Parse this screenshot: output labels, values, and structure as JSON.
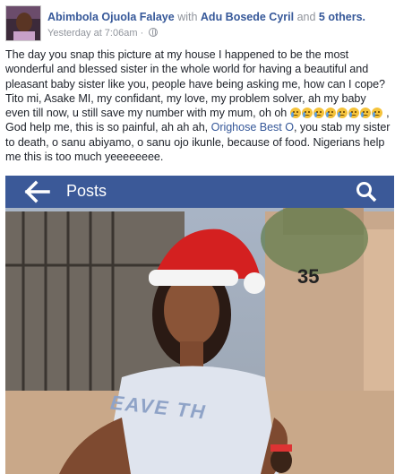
{
  "header": {
    "author": "Abimbola Ojuola Falaye",
    "with_word": "with",
    "tagged_person": "Adu Bosede Cyril",
    "and_word": "and",
    "others": "5 others.",
    "timestamp": "Yesterday at 7:06am",
    "separator": "·",
    "privacy_icon": "globe-icon"
  },
  "post": {
    "text_part1": "The day you snap this picture at my house I happened to be the most wonderful and blessed sister in the whole world for having a beautiful and pleasant baby sister like you, people have being asking me, how can I cope? Tito mi, Asake MI, my confidant, my love, my problem solver, ah my baby even till now, u still save my number with my mum, oh oh",
    "text_part2": ", God help me, this is so painful, ah ah ah,",
    "mention": "Orighose Best O",
    "text_part3": ", you stab my sister to death, o sanu abiyamo, o sanu ojo ikunle, because of food. Nigerians help me this is too much yeeeeeeee."
  },
  "photo": {
    "app_bar_title": "Posts",
    "back_icon": "arrow-left-icon",
    "search_icon": "search-icon",
    "house_number": "35",
    "shirt_text": "EAVE TH",
    "bar_color": "#3b5998"
  }
}
